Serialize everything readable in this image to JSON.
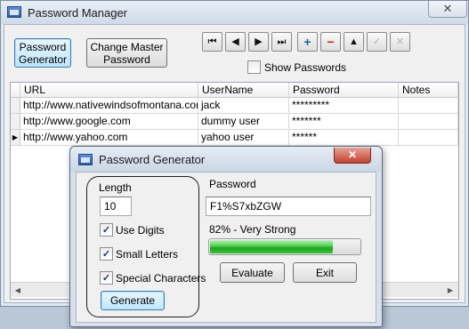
{
  "main_window": {
    "title": "Password Manager",
    "close_glyph": "✕",
    "toolbar": {
      "password_generator_label": "Password\nGenerator",
      "change_master_label": "Change Master\nPassword",
      "nav_buttons": [
        {
          "name": "first-record-icon",
          "glyph": "⏮"
        },
        {
          "name": "previous-record-icon",
          "glyph": "◀"
        },
        {
          "name": "next-record-icon",
          "glyph": "▶"
        },
        {
          "name": "last-record-icon",
          "glyph": "⏭"
        },
        {
          "name": "add-record-icon",
          "glyph": "+"
        },
        {
          "name": "delete-record-icon",
          "glyph": "−"
        },
        {
          "name": "edit-record-icon",
          "glyph": "▲"
        },
        {
          "name": "save-record-icon",
          "glyph": "✓"
        },
        {
          "name": "cancel-edit-icon",
          "glyph": "✕"
        }
      ],
      "show_passwords_label": "Show Passwords",
      "show_passwords_checked": false
    },
    "grid": {
      "columns": [
        "URL",
        "UserName",
        "Password",
        "Notes"
      ],
      "rows": [
        {
          "url": "http://www.nativewindsofmontana.com",
          "username": "jack",
          "password": "*********",
          "notes": "",
          "current": false
        },
        {
          "url": "http://www.google.com",
          "username": "dummy user",
          "password": "*******",
          "notes": "",
          "current": false
        },
        {
          "url": "http://www.yahoo.com",
          "username": "yahoo user",
          "password": "******",
          "notes": "",
          "current": true
        }
      ],
      "current_row_marker": "▶"
    }
  },
  "dialog": {
    "title": "Password Generator",
    "close_glyph": "✕",
    "length_label": "Length",
    "length_value": "10",
    "options": [
      {
        "label": "Use Digits",
        "checked": true
      },
      {
        "label": "Small Letters",
        "checked": true
      },
      {
        "label": "Special Characters",
        "checked": true
      }
    ],
    "check_glyph": "✓",
    "generate_label": "Generate",
    "password_label": "Password",
    "password_value": "F1%S7xbZGW",
    "strength_text": "82% - Very Strong",
    "strength_percent": 82,
    "evaluate_label": "Evaluate",
    "exit_label": "Exit"
  },
  "colors": {
    "progress_green": "#1ca51c",
    "title_bar": "#cfdbe8",
    "dialog_close_red": "#c4412e"
  }
}
